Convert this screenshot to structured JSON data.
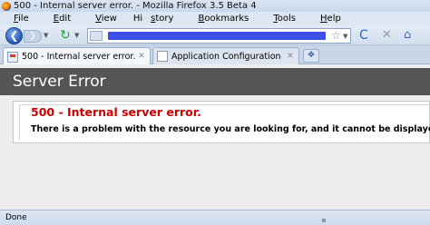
{
  "window": {
    "title": "500 - Internal server error. - Mozilla Firefox 3.5 Beta 4"
  },
  "menu": {
    "items": [
      {
        "pre": "",
        "key": "F",
        "post": "ile"
      },
      {
        "pre": "",
        "key": "E",
        "post": "dit"
      },
      {
        "pre": "",
        "key": "V",
        "post": "iew"
      },
      {
        "pre": "Hi",
        "key": "s",
        "post": "tory"
      },
      {
        "pre": "",
        "key": "B",
        "post": "ookmarks"
      },
      {
        "pre": "",
        "key": "T",
        "post": "ools"
      },
      {
        "pre": "",
        "key": "H",
        "post": "elp"
      }
    ]
  },
  "navbar": {
    "back_glyph": "❮",
    "forward_glyph": "❯",
    "reload_glyph": "↻",
    "refresh_glyph": "C",
    "stop_glyph": "✕",
    "home_glyph": "⌂",
    "star_glyph": "☆",
    "dropdown_glyph": "▼"
  },
  "tabs": [
    {
      "label": "500 - Internal server error.",
      "active": true
    },
    {
      "label": "Application Configuration",
      "active": false
    }
  ],
  "tab_close_glyph": "✕",
  "new_tab_glyph": "✥",
  "page": {
    "header": "Server Error",
    "error_title": "500 - Internal server error.",
    "error_message": "There is a problem with the resource you are looking for, and it cannot be displayed.",
    "header_bg": "#555555",
    "error_color": "#cc0000"
  },
  "status": {
    "text": "Done"
  }
}
